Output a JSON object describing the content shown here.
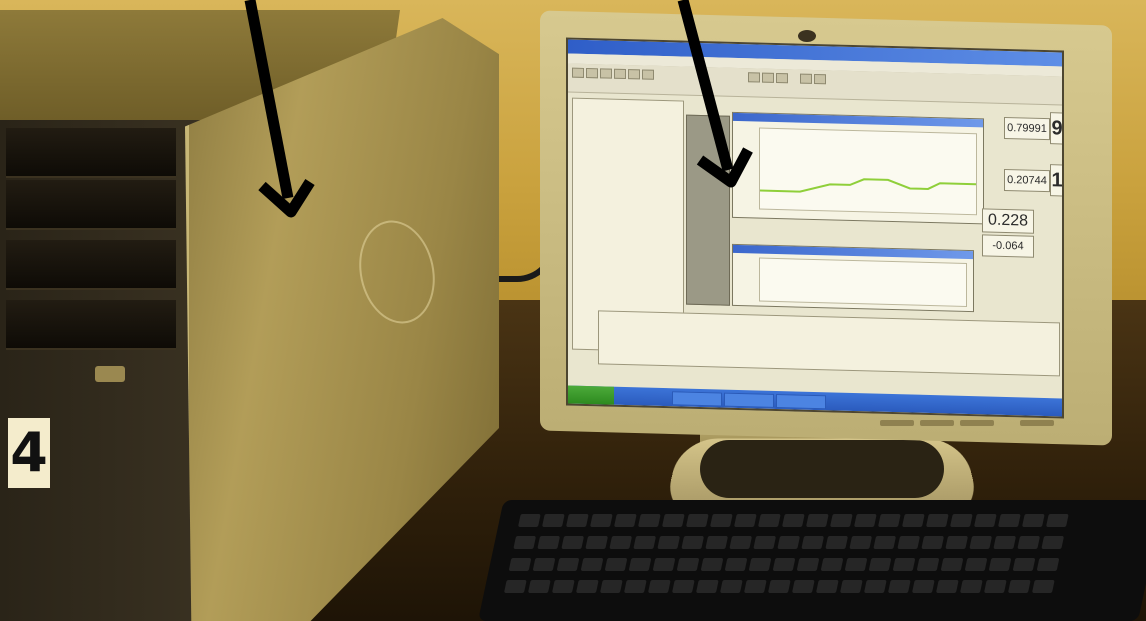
{
  "monitor": {
    "readouts": [
      {
        "id": "r1",
        "value": "0.79991"
      },
      {
        "id": "r2",
        "value": "9"
      },
      {
        "id": "r3",
        "value": "0.20744"
      },
      {
        "id": "r4",
        "value": "1"
      },
      {
        "id": "r5",
        "value": "0.228"
      },
      {
        "id": "r6",
        "value": "-0.064"
      }
    ]
  },
  "tower": {
    "label": "4"
  },
  "colors": {
    "wall": "#d9b65a",
    "desk": "#2e1f0a",
    "plot_trace": "#8fcf3a",
    "arrow": "#000000"
  },
  "icons": [
    "arrow-down-icon",
    "hp-logo-icon"
  ]
}
